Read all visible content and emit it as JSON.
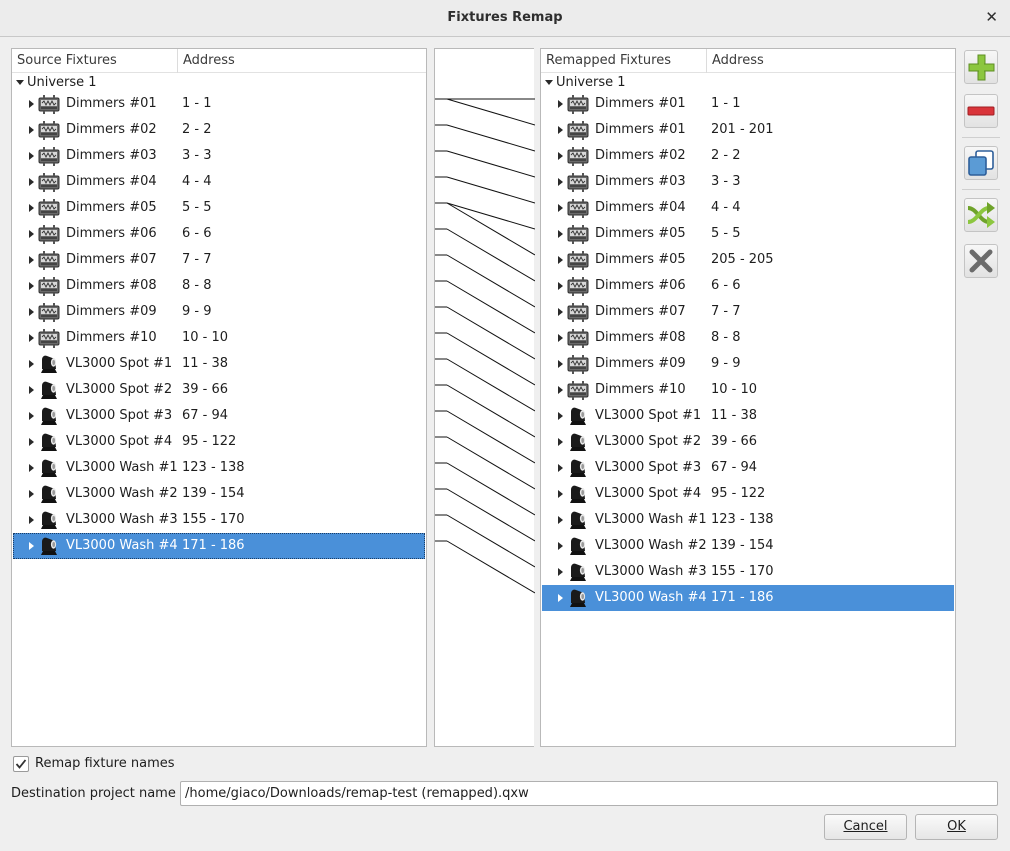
{
  "window": {
    "title": "Fixtures Remap"
  },
  "source": {
    "col_name": "Source Fixtures",
    "col_address": "Address",
    "universe": "Universe 1",
    "fixtures": [
      {
        "name": "Dimmers #01",
        "address": "1 - 1",
        "type": "dimmer"
      },
      {
        "name": "Dimmers #02",
        "address": "2 - 2",
        "type": "dimmer"
      },
      {
        "name": "Dimmers #03",
        "address": "3 - 3",
        "type": "dimmer"
      },
      {
        "name": "Dimmers #04",
        "address": "4 - 4",
        "type": "dimmer"
      },
      {
        "name": "Dimmers #05",
        "address": "5 - 5",
        "type": "dimmer"
      },
      {
        "name": "Dimmers #06",
        "address": "6 - 6",
        "type": "dimmer"
      },
      {
        "name": "Dimmers #07",
        "address": "7 - 7",
        "type": "dimmer"
      },
      {
        "name": "Dimmers #08",
        "address": "8 - 8",
        "type": "dimmer"
      },
      {
        "name": "Dimmers #09",
        "address": "9 - 9",
        "type": "dimmer"
      },
      {
        "name": "Dimmers #10",
        "address": "10 - 10",
        "type": "dimmer"
      },
      {
        "name": "VL3000 Spot #1",
        "address": "11 - 38",
        "type": "moving-head"
      },
      {
        "name": "VL3000 Spot #2",
        "address": "39 - 66",
        "type": "moving-head"
      },
      {
        "name": "VL3000 Spot #3",
        "address": "67 - 94",
        "type": "moving-head"
      },
      {
        "name": "VL3000 Spot #4",
        "address": "95 - 122",
        "type": "moving-head"
      },
      {
        "name": "VL3000 Wash #1",
        "address": "123 - 138",
        "type": "moving-head"
      },
      {
        "name": "VL3000 Wash #2",
        "address": "139 - 154",
        "type": "moving-head"
      },
      {
        "name": "VL3000 Wash #3",
        "address": "155 - 170",
        "type": "moving-head"
      },
      {
        "name": "VL3000 Wash #4",
        "address": "171 - 186",
        "type": "moving-head",
        "selected": true
      }
    ]
  },
  "remapped": {
    "col_name": "Remapped Fixtures",
    "col_address": "Address",
    "universe": "Universe 1",
    "fixtures": [
      {
        "name": "Dimmers #01",
        "address": "1 - 1",
        "type": "dimmer"
      },
      {
        "name": "Dimmers #01",
        "address": "201 - 201",
        "type": "dimmer"
      },
      {
        "name": "Dimmers #02",
        "address": "2 - 2",
        "type": "dimmer"
      },
      {
        "name": "Dimmers #03",
        "address": "3 - 3",
        "type": "dimmer"
      },
      {
        "name": "Dimmers #04",
        "address": "4 - 4",
        "type": "dimmer"
      },
      {
        "name": "Dimmers #05",
        "address": "5 - 5",
        "type": "dimmer"
      },
      {
        "name": "Dimmers #05",
        "address": "205 - 205",
        "type": "dimmer"
      },
      {
        "name": "Dimmers #06",
        "address": "6 - 6",
        "type": "dimmer"
      },
      {
        "name": "Dimmers #07",
        "address": "7 - 7",
        "type": "dimmer"
      },
      {
        "name": "Dimmers #08",
        "address": "8 - 8",
        "type": "dimmer"
      },
      {
        "name": "Dimmers #09",
        "address": "9 - 9",
        "type": "dimmer"
      },
      {
        "name": "Dimmers #10",
        "address": "10 - 10",
        "type": "dimmer"
      },
      {
        "name": "VL3000 Spot #1",
        "address": "11 - 38",
        "type": "moving-head"
      },
      {
        "name": "VL3000 Spot #2",
        "address": "39 - 66",
        "type": "moving-head"
      },
      {
        "name": "VL3000 Spot #3",
        "address": "67 - 94",
        "type": "moving-head"
      },
      {
        "name": "VL3000 Spot #4",
        "address": "95 - 122",
        "type": "moving-head"
      },
      {
        "name": "VL3000 Wash #1",
        "address": "123 - 138",
        "type": "moving-head"
      },
      {
        "name": "VL3000 Wash #2",
        "address": "139 - 154",
        "type": "moving-head"
      },
      {
        "name": "VL3000 Wash #3",
        "address": "155 - 170",
        "type": "moving-head"
      },
      {
        "name": "VL3000 Wash #4",
        "address": "171 - 186",
        "type": "moving-head",
        "selected": true
      }
    ]
  },
  "mappings": [
    [
      0,
      0
    ],
    [
      0,
      1
    ],
    [
      1,
      2
    ],
    [
      2,
      3
    ],
    [
      3,
      4
    ],
    [
      4,
      5
    ],
    [
      4,
      6
    ],
    [
      5,
      7
    ],
    [
      6,
      8
    ],
    [
      7,
      9
    ],
    [
      8,
      10
    ],
    [
      9,
      11
    ],
    [
      10,
      12
    ],
    [
      11,
      13
    ],
    [
      12,
      14
    ],
    [
      13,
      15
    ],
    [
      14,
      16
    ],
    [
      15,
      17
    ],
    [
      16,
      18
    ],
    [
      17,
      19
    ]
  ],
  "toolbar": {
    "buttons": [
      {
        "name": "add-remap-button",
        "icon": "plus-icon"
      },
      {
        "name": "remove-remap-button",
        "icon": "minus-icon"
      },
      {
        "name": "clone-button",
        "icon": "clone-icon"
      },
      {
        "name": "auto-remap-button",
        "icon": "shuffle-icon"
      },
      {
        "name": "clear-remap-button",
        "icon": "x-icon"
      }
    ]
  },
  "options": {
    "remap_names_label": "Remap fixture names",
    "remap_names_checked": true,
    "dest_label": "Destination project name",
    "dest_value": "/home/giaco/Downloads/remap-test (remapped).qxw"
  },
  "buttons": {
    "cancel": "Cancel",
    "ok": "OK"
  },
  "colors": {
    "selection": "#4a90d9",
    "plus": "#8cc63f",
    "minus": "#d9343a"
  }
}
